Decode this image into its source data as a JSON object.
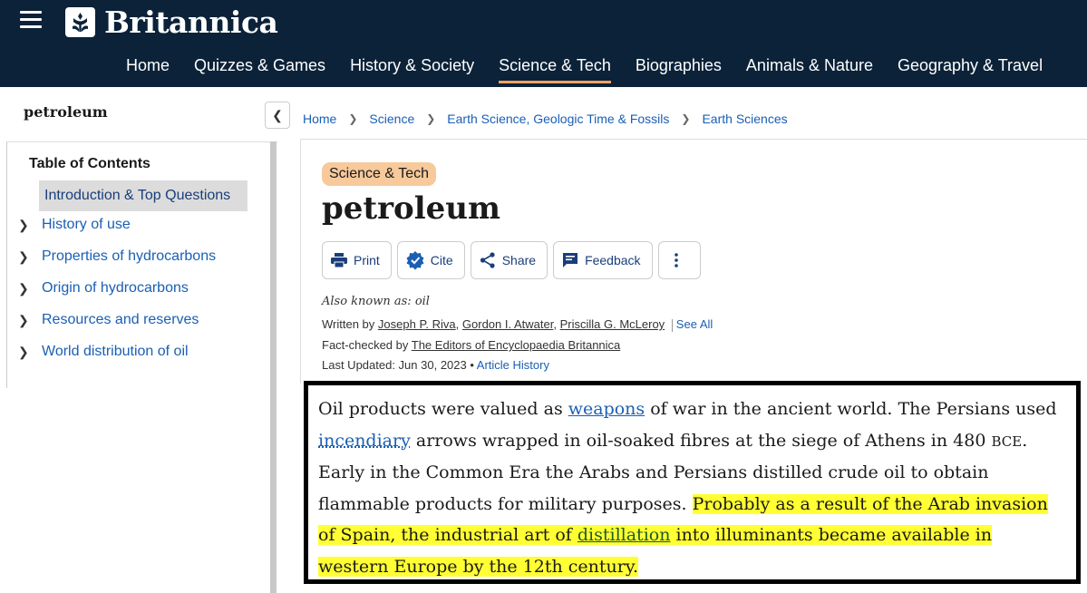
{
  "header": {
    "logo_text": "Britannica",
    "nav": [
      "Home",
      "Quizzes & Games",
      "History & Society",
      "Science & Tech",
      "Biographies",
      "Animals & Nature",
      "Geography & Travel"
    ],
    "active_nav": "Science & Tech",
    "accent_color": "#f4a261"
  },
  "sidebar": {
    "title": "petroleum",
    "toc_heading": "Table of Contents",
    "toc_intro": "Introduction & Top Questions",
    "toc_items": [
      "History of use",
      "Properties of hydrocarbons",
      "Origin of hydrocarbons",
      "Resources and reserves",
      "World distribution of oil"
    ]
  },
  "breadcrumb": [
    "Home",
    "Science",
    "Earth Science, Geologic Time & Fossils",
    "Earth Sciences"
  ],
  "article": {
    "category_badge": "Science & Tech",
    "title": "petroleum",
    "actions": {
      "print": "Print",
      "cite": "Cite",
      "share": "Share",
      "feedback": "Feedback"
    },
    "also_known": "Also known as: oil",
    "written_by_label": "Written by",
    "authors": [
      "Joseph P. Riva",
      "Gordon I. Atwater",
      "Priscilla G. McLeroy"
    ],
    "see_all": "See All",
    "fact_checked_label": "Fact-checked by",
    "fact_checker": "The Editors of Encyclopaedia Britannica",
    "last_updated": "Last Updated: Jun 30, 2023",
    "article_history": "Article History"
  },
  "excerpt": {
    "t1": "Oil products were valued as ",
    "link_weapons": "weapons",
    "t2": " of war in the ancient world. The Persians used ",
    "link_incendiary": "incendiary",
    "t3": " arrows wrapped in oil-soaked fibres at the siege of Athens in 480 ",
    "bce": "BCE",
    "t4": ". Early in the Common Era the Arabs and Persians distilled crude oil to obtain flammable products for military purposes. ",
    "h1": "Probably as a result of the Arab invasion of Spain, the industrial art of ",
    "link_distillation": "distillation",
    "h2": " into illuminants became available in western Europe by the 12th century.",
    "highlight_color": "#ffff33"
  }
}
